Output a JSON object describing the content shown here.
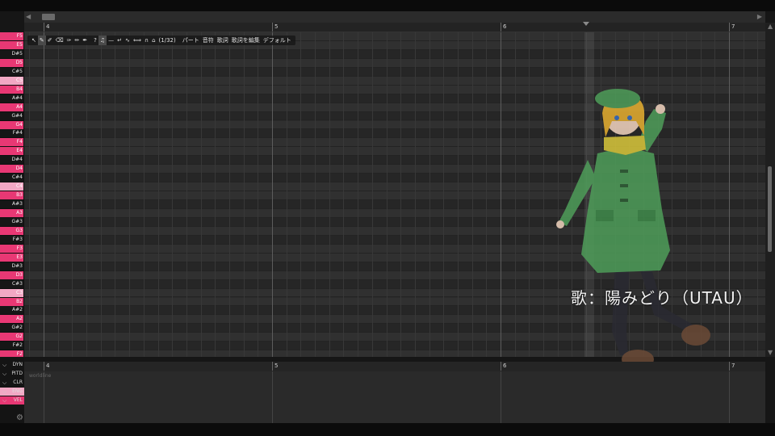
{
  "ruler": {
    "markers": [
      "4",
      "5",
      "6",
      "7"
    ]
  },
  "toolbar": {
    "tools": [
      {
        "icon": "cursor-icon",
        "glyph": "↖"
      },
      {
        "icon": "pencil-icon",
        "glyph": "✎"
      },
      {
        "icon": "pen-plus-icon",
        "glyph": "✐"
      },
      {
        "icon": "eraser-icon",
        "glyph": "⌫"
      },
      {
        "icon": "draw-pitch-icon",
        "glyph": "✑"
      },
      {
        "icon": "overwrite-pitch-icon",
        "glyph": "✏"
      },
      {
        "icon": "knife-icon",
        "glyph": "✒"
      }
    ],
    "toggles": [
      {
        "icon": "help-icon",
        "glyph": "?"
      },
      {
        "icon": "note-icon",
        "glyph": "♫"
      },
      {
        "icon": "pitch-line-icon",
        "glyph": "—"
      },
      {
        "icon": "snap-icon",
        "glyph": "↵"
      },
      {
        "icon": "vibrato-icon",
        "glyph": "∿"
      },
      {
        "icon": "phoneme-icon",
        "glyph": "⟺"
      },
      {
        "icon": "tips-icon",
        "glyph": "∩"
      },
      {
        "icon": "playhead-follow-icon",
        "glyph": "⌂"
      }
    ],
    "snap": "(1/32)",
    "menus": [
      "パート",
      "音符",
      "歌詞",
      "歌詞を編集",
      "デフォルト"
    ]
  },
  "keys": [
    {
      "label": "F5",
      "type": "white"
    },
    {
      "label": "E5",
      "type": "white"
    },
    {
      "label": "D#5",
      "type": "black"
    },
    {
      "label": "D5",
      "type": "white"
    },
    {
      "label": "C#5",
      "type": "black"
    },
    {
      "label": "C5",
      "type": "light"
    },
    {
      "label": "B4",
      "type": "white"
    },
    {
      "label": "A#4",
      "type": "black"
    },
    {
      "label": "A4",
      "type": "white"
    },
    {
      "label": "G#4",
      "type": "black"
    },
    {
      "label": "G4",
      "type": "white"
    },
    {
      "label": "F#4",
      "type": "black"
    },
    {
      "label": "F4",
      "type": "white"
    },
    {
      "label": "E4",
      "type": "white"
    },
    {
      "label": "D#4",
      "type": "black"
    },
    {
      "label": "D4",
      "type": "white"
    },
    {
      "label": "C#4",
      "type": "black"
    },
    {
      "label": "C4",
      "type": "light"
    },
    {
      "label": "B3",
      "type": "white"
    },
    {
      "label": "A#3",
      "type": "black"
    },
    {
      "label": "A3",
      "type": "white"
    },
    {
      "label": "G#3",
      "type": "black"
    },
    {
      "label": "G3",
      "type": "white"
    },
    {
      "label": "F#3",
      "type": "black"
    },
    {
      "label": "F3",
      "type": "white"
    },
    {
      "label": "E3",
      "type": "white"
    },
    {
      "label": "D#3",
      "type": "black"
    },
    {
      "label": "D3",
      "type": "white"
    },
    {
      "label": "C#3",
      "type": "black"
    },
    {
      "label": "C3",
      "type": "light"
    },
    {
      "label": "B2",
      "type": "white"
    },
    {
      "label": "A#2",
      "type": "black"
    },
    {
      "label": "A2",
      "type": "white"
    },
    {
      "label": "G#2",
      "type": "black"
    },
    {
      "label": "G2",
      "type": "white"
    },
    {
      "label": "F#2",
      "type": "black"
    },
    {
      "label": "F2",
      "type": "white"
    }
  ],
  "expressions": [
    {
      "name": "DYN",
      "style": "normal"
    },
    {
      "name": "PITD",
      "style": "normal"
    },
    {
      "name": "CLR",
      "style": "normal"
    },
    {
      "name": "ENG",
      "style": "lightpink"
    },
    {
      "name": "VEL",
      "style": "pink"
    }
  ],
  "expression_hint": "worldline",
  "lyric_overlay": "歌：陽みどり（UTAU）",
  "colors": {
    "white_key": "#e83874",
    "highlight_key": "#f2a8c4",
    "coat": "#4f9e5a",
    "hair": "#e8b030",
    "scarf": "#d9c73a"
  }
}
